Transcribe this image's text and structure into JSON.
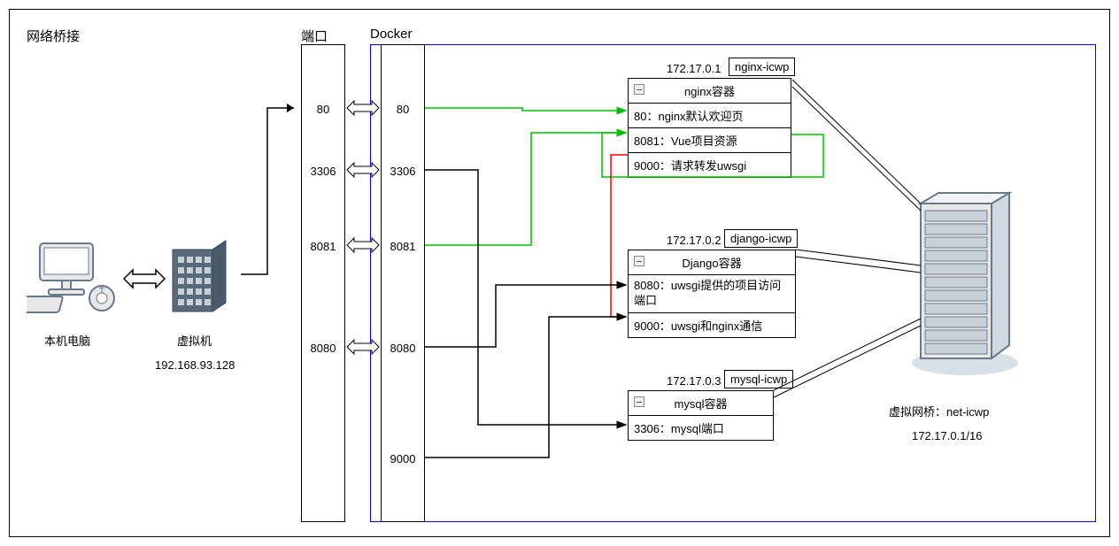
{
  "outer": {
    "bridge_label": "网络桥接",
    "port_label": "端口",
    "docker_label": "Docker"
  },
  "local_pc": {
    "label": "本机电脑"
  },
  "vm": {
    "label": "虚拟机",
    "ip": "192.168.93.128"
  },
  "ports_left": [
    "80",
    "3306",
    "8081",
    "8080"
  ],
  "ports_right": [
    "80",
    "3306",
    "8081",
    "8080",
    "9000"
  ],
  "nginx": {
    "ip": "172.17.0.1",
    "name": "nginx-icwp",
    "title": "nginx容器",
    "rows": [
      "80：nginx默认欢迎页",
      "8081：Vue项目资源",
      "9000：请求转发uwsgi"
    ]
  },
  "django": {
    "ip": "172.17.0.2",
    "name": "django-icwp",
    "title": "Django容器",
    "rows": [
      "8080：uwsgi提供的项目访问端口",
      "9000：uwsgi和nginx通信"
    ]
  },
  "mysql": {
    "ip": "172.17.0.3",
    "name": "mysql-icwp",
    "title": "mysql容器",
    "rows": [
      "3306：mysql端口"
    ]
  },
  "bridge": {
    "label": "虚拟网桥：net-icwp",
    "cidr": "172.17.0.1/16"
  }
}
